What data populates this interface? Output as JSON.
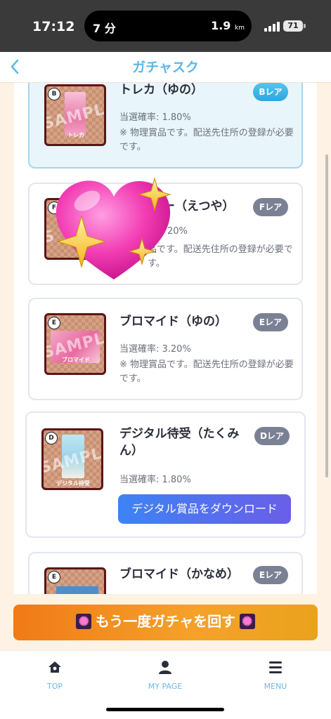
{
  "status_bar": {
    "time": "17:12",
    "activity_left": "7 分",
    "activity_right_value": "1.9",
    "activity_right_unit": "km",
    "battery": "71"
  },
  "header": {
    "title": "ガチャスク",
    "back_icon": "chevron-left-icon"
  },
  "prizes": [
    {
      "name": "トレカ（ゆの）",
      "rarity": "Bレア",
      "probability": "当選確率: 1.80%",
      "note": "※ 物理賞品です。配送先住所の登録が必要です。",
      "thumb_rank": "B",
      "thumb_label": "トレカ",
      "watermark": "SAMPLE",
      "selected": true
    },
    {
      "name": "ー（えつや）",
      "rarity": "Fレア",
      "probability": "20%",
      "note": "品です。配送先住所の登録が必要です。",
      "thumb_rank": "F",
      "watermark": "S"
    },
    {
      "name": "ブロマイド（ゆの）",
      "rarity": "Eレア",
      "probability": "当選確率: 3.20%",
      "note": "※ 物理賞品です。配送先住所の登録が必要です。",
      "thumb_rank": "E",
      "thumb_label": "ブロマイド",
      "watermark": "SAMPLE"
    },
    {
      "name": "デジタル待受（たくみん）",
      "rarity": "Dレア",
      "probability": "当選確率: 1.80%",
      "download_label": "デジタル賞品をダウンロード",
      "thumb_rank": "D",
      "thumb_label": "デジタル待受",
      "watermark": "SAMPLE"
    },
    {
      "name": "ブロマイド（かなめ）",
      "rarity": "Eレア",
      "thumb_rank": "E"
    }
  ],
  "retry_button": {
    "label": "もう一度ガチャを回す"
  },
  "nav": [
    {
      "label": "TOP",
      "icon": "home-icon"
    },
    {
      "label": "MY PAGE",
      "icon": "user-icon"
    },
    {
      "label": "MENU",
      "icon": "menu-icon"
    }
  ],
  "sticker": {
    "icon": "sparkling-heart-icon"
  },
  "colors": {
    "accent": "#5bb8e6",
    "rarity_b": "#2ea6df",
    "rarity_other": "#7b8194",
    "cta_orange": "#f07a17",
    "download_blue": "#3d83f5",
    "thumb_border": "#5a1616",
    "page_bg": "#fdf2e3"
  }
}
